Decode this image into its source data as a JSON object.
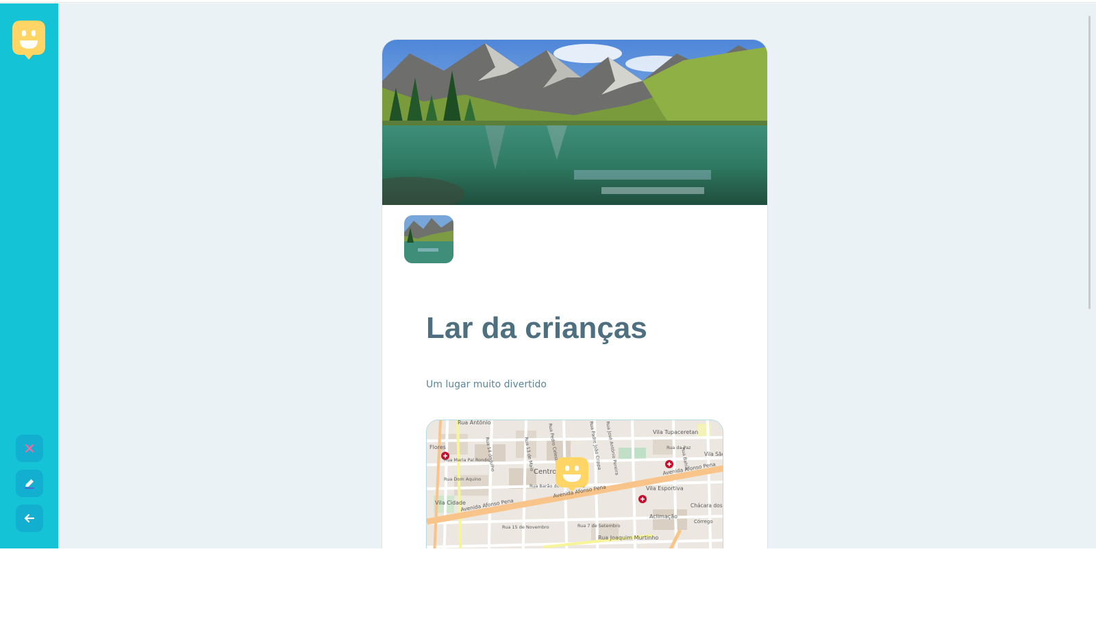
{
  "sidebar": {
    "logo_icon": "happy-speech-bubble-logo-icon",
    "buttons": [
      {
        "name": "close-button",
        "icon": "close-icon",
        "color": "#ff669d"
      },
      {
        "name": "edit-button",
        "icon": "pencil-icon",
        "color": "#ffffff"
      },
      {
        "name": "back-button",
        "icon": "arrow-left-icon",
        "color": "#ffffff"
      }
    ]
  },
  "orphanage": {
    "cover_image": "mountain-lake-landscape",
    "avatar_image": "mountain-lake-thumbnail",
    "name": "Lar da crianças",
    "about": "Um lugar muito divertido"
  },
  "map": {
    "marker_icon": "happy-face-marker-icon",
    "labels": [
      "Rua Antônio",
      "Vila Tupaceretan",
      "Flores",
      "Rua Maria Pal Rondon",
      "Rua Dom Aquino",
      "Rua 14 de Julho",
      "Rua 13 de Maio",
      "Rua Barbosa",
      "Rua Barão do Rio Branco",
      "Rua Pedro Celestino",
      "Rua Padre João Crippa",
      "Rua José Antônio Pereira",
      "Rua 13 de Junho",
      "Rua da Paz",
      "Vila São",
      "Rua Bahia",
      "Avenida Afonso Pena",
      "Vila Esportiva",
      "Centro",
      "Vila Cidade",
      "Rua 15 de Novembro",
      "Rua 7 de Setembro",
      "Aclimação",
      "Chácara dos Coqueiros",
      "Córrego",
      "Rua Joaquim Murtinho"
    ]
  },
  "colors": {
    "sidebar": "#15c3d6",
    "background": "#ebf2f5",
    "title": "#4d6f80",
    "subtitle": "#5c8599",
    "logo": "#ffd666"
  }
}
